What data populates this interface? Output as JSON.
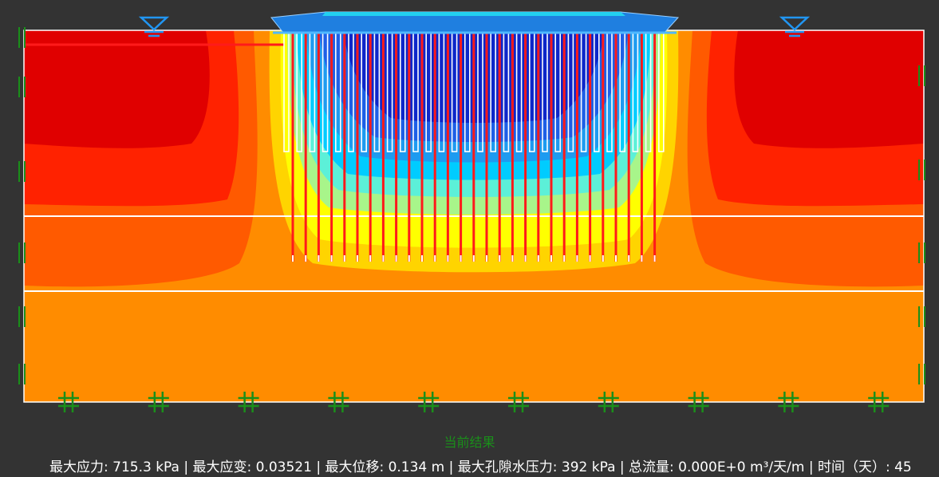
{
  "status_title": "当前结果",
  "results": {
    "line": "最大应力: 715.3 kPa | 最大应变: 0.03521 | 最大位移: 0.134 m | 最大孔隙水压力: 392 kPa | 总流量: 0.000E+0 m³/天/m | 时间（天）: 45"
  },
  "colors": {
    "background": "#333333",
    "contour_scale": [
      "#0d27c9",
      "#1e5fe6",
      "#1e9bf0",
      "#00ccff",
      "#5cf0d8",
      "#a8f58a",
      "#ffff00",
      "#ffd400",
      "#ff8c00",
      "#ff5a00",
      "#ff2200",
      "#e00000"
    ],
    "pile": "#ff1a1a",
    "drain": "#ffffff",
    "boundary_support": "#1a8f1a",
    "water_level": "#2196f3",
    "embankment": "#1f7fe0"
  },
  "icons": {
    "water_level": "water-level-triangle-icon",
    "roller_support": "roller-support-icon",
    "fixed_support": "fixed-support-hash-icon"
  }
}
